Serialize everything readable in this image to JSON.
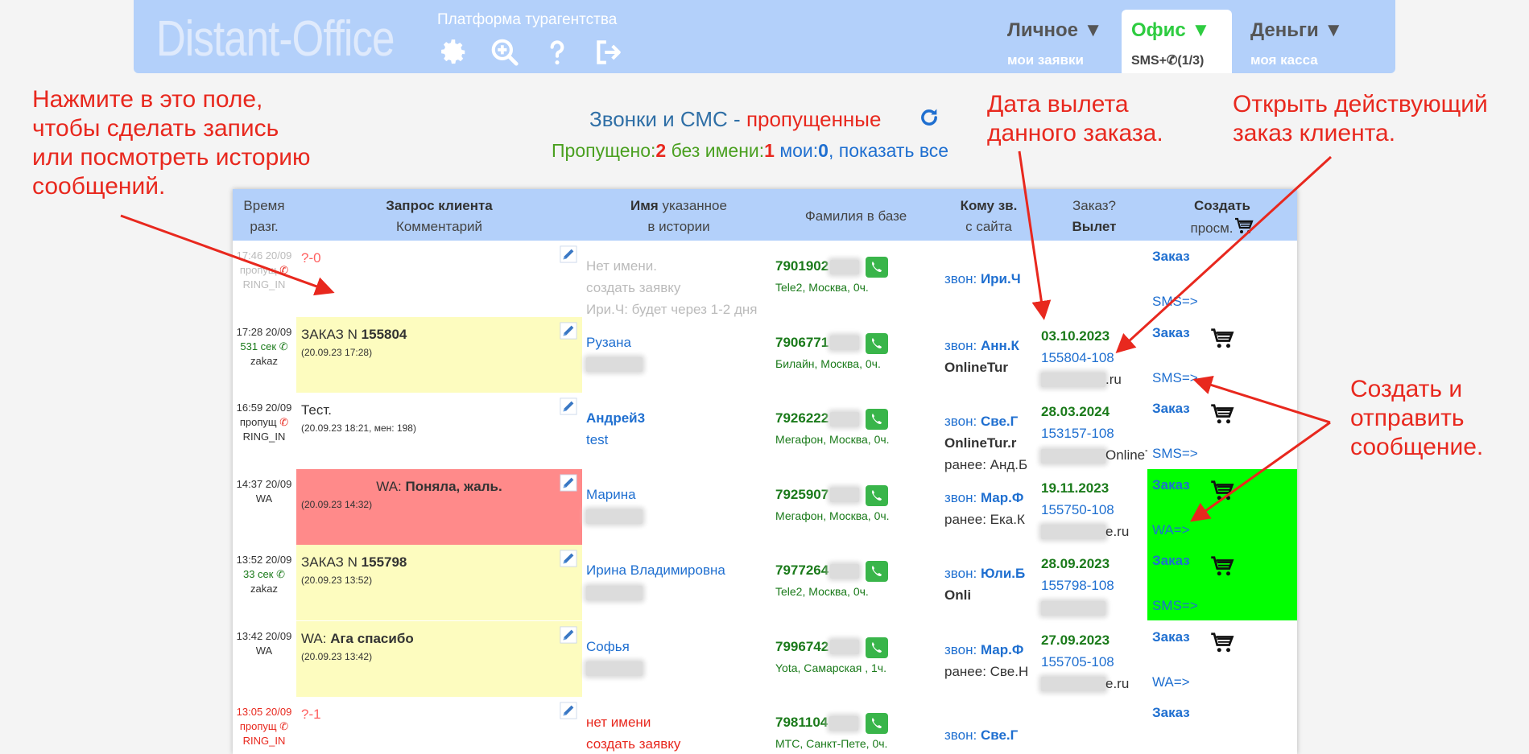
{
  "header": {
    "logo": "Distant-Office",
    "platform": "Платформа турагентства",
    "icons": [
      "gear-icon",
      "zoom-in-icon",
      "help-icon",
      "logout-icon"
    ],
    "menus": [
      {
        "label": "Личное ▼",
        "sub": "мои заявки",
        "color": "#555555"
      },
      {
        "label": "Офис ▼",
        "sub": "SMS+✆(1/3)",
        "color": "#2ecc40",
        "active": true
      },
      {
        "label": "Деньги ▼",
        "sub": "моя касса",
        "color": "#555555"
      }
    ]
  },
  "annotations": {
    "a1": "Нажмите в это поле,\nчтобы сделать запись\nили посмотреть историю\nсообщений.",
    "a2": "Дата вылета\nданного заказа.",
    "a3": "Открыть действующий\nзаказ клиента.",
    "a4": "Создать и\nотправить\nсообщение."
  },
  "heading": {
    "text": "Звонки и СМС - ",
    "red": "пропущенные"
  },
  "counts": {
    "missed_label": "Пропущено:",
    "missed": "2",
    "noname_label": " без имени:",
    "noname": "1",
    "mine_label": " мои:",
    "mine": "0",
    "show_all": ", показать все"
  },
  "table": {
    "headers": {
      "time1": "Время",
      "time2": "разг.",
      "req1": "Запрос клиента",
      "req2": "Комментарий",
      "name1": "Имя",
      "name1b": " указанное",
      "name2": "в истории",
      "surname": "Фамилия в базе",
      "who1": "Кому зв.",
      "who2": "с сайта",
      "order1": "Заказ?",
      "order2": "Вылет",
      "create1": "Создать",
      "create2": "просм."
    },
    "rows": [
      {
        "time": "17:46 20/09",
        "dur": "пропущ",
        "src": "RING_IN",
        "req_title": "?-0",
        "req_sub": "",
        "bg": "#ffffff",
        "dim": true,
        "name1": "Нет имени.",
        "name2": "создать заявку",
        "name3": "Ири.Ч: будет через 1-2 дня",
        "phone": "7901902",
        "op": "Tele2, Москва, 0ч.",
        "who_lbl": "звон: ",
        "who": "Ири.Ч",
        "who2": "",
        "dep_date": "",
        "dep_order": "",
        "dep_site": "",
        "order": "Заказ",
        "sms": "SMS=>",
        "cr_bg": "#ffffff",
        "cart": false
      },
      {
        "time": "17:28 20/09",
        "dur": "531 сек",
        "src": "zakaz",
        "req_title": "ЗАКАЗ N ",
        "req_bold": "155804",
        "req_sub": "(20.09.23 17:28)",
        "bg": "#fdfcbf",
        "name1": "Рузана",
        "name2": "",
        "phone": "7906771",
        "op": "Билайн, Москва, 0ч.",
        "who_lbl": "звон: ",
        "who": "Анн.К",
        "who2": "OnlineTur",
        "dep_date": "03.10.2023",
        "dep_order": "155804-108",
        "dep_site": ".ru",
        "order": "Заказ",
        "sms": "SMS=>",
        "cr_bg": "#ffffff",
        "cart": true
      },
      {
        "time": "16:59 20/09",
        "dur": "пропущ",
        "src": "RING_IN",
        "req_title": "Тест.",
        "req_sub": "(20.09.23 18:21, мен: 198)",
        "bg": "#ffffff",
        "name1": "Андрей3",
        "name2": "test",
        "phone": "7926222",
        "op": "Мегафон, Москва, 0ч.",
        "who_lbl": "звон: ",
        "who": "Све.Г",
        "who2": "OnlineTur.r",
        "who3": "ранее: Анд.Б",
        "dep_date": "28.03.2024",
        "dep_order": "153157-108",
        "dep_site": "OnlineTur.ru",
        "order": "Заказ",
        "sms": "SMS=>",
        "cr_bg": "#ffffff",
        "cart": true
      },
      {
        "time": "14:37 20/09",
        "dur": "",
        "src": "WA",
        "req_title": "WA: ",
        "req_bold": "Поняла, жаль.",
        "req_sub": "(20.09.23 14:32)",
        "bg": "#ff8a8a",
        "center": true,
        "name1": "Марина",
        "name2": "",
        "phone": "7925907",
        "op": "Мегафон, Москва, 0ч.",
        "who_lbl": "звон: ",
        "who": "Мар.Ф",
        "who2": "",
        "who3": "ранее: Ека.К",
        "dep_date": "19.11.2023",
        "dep_order": "155750-108",
        "dep_site": "e.ru",
        "order": "Заказ",
        "sms": "WA=>",
        "cr_bg": "#00ff00",
        "cart": true
      },
      {
        "time": "13:52 20/09",
        "dur": "33 сек",
        "src": "zakaz",
        "req_title": "ЗАКАЗ N ",
        "req_bold": "155798",
        "req_sub": "(20.09.23 13:52)",
        "bg": "#fdfcbf",
        "name1": "Ирина Владимировна",
        "name2": "",
        "phone": "7977264",
        "op": "Tele2, Москва, 0ч.",
        "who_lbl": "звон: ",
        "who": "Юли.Б",
        "who2": "Onli",
        "dep_date": "28.09.2023",
        "dep_order": "155798-108",
        "dep_site": "",
        "order": "Заказ",
        "sms": "SMS=>",
        "cr_bg": "#00ff00",
        "cart": true
      },
      {
        "time": "13:42 20/09",
        "dur": "",
        "src": "WA",
        "req_title": "WA: ",
        "req_bold": "Ага спасибо",
        "req_sub": "(20.09.23 13:42)",
        "bg": "#fdfcbf",
        "name1": "Софья",
        "name2": "",
        "phone": "7996742",
        "op": "Yota, Самарская , 1ч.",
        "who_lbl": "звон: ",
        "who": "Мар.Ф",
        "who2": "",
        "who3": "ранее: Све.Н",
        "dep_date": "27.09.2023",
        "dep_order": "155705-108",
        "dep_site": "e.ru",
        "order": "Заказ",
        "sms": "WA=>",
        "cr_bg": "#ffffff",
        "cart": true
      },
      {
        "time": "13:05 20/09",
        "dur": "пропущ",
        "src": "RING_IN",
        "req_title": "?-1",
        "req_sub": "",
        "bg": "#ffffff",
        "missed": true,
        "name1": "нет имени",
        "name2": "создать заявку",
        "phone": "7981104",
        "op": "МТС, Санкт-Пете, 0ч.",
        "who_lbl": "звон: ",
        "who": "Све.Г",
        "who2": "",
        "dep_date": "",
        "dep_order": "",
        "dep_site": "",
        "order": "Заказ",
        "sms": "",
        "cr_bg": "#ffffff",
        "cart": false
      }
    ]
  }
}
